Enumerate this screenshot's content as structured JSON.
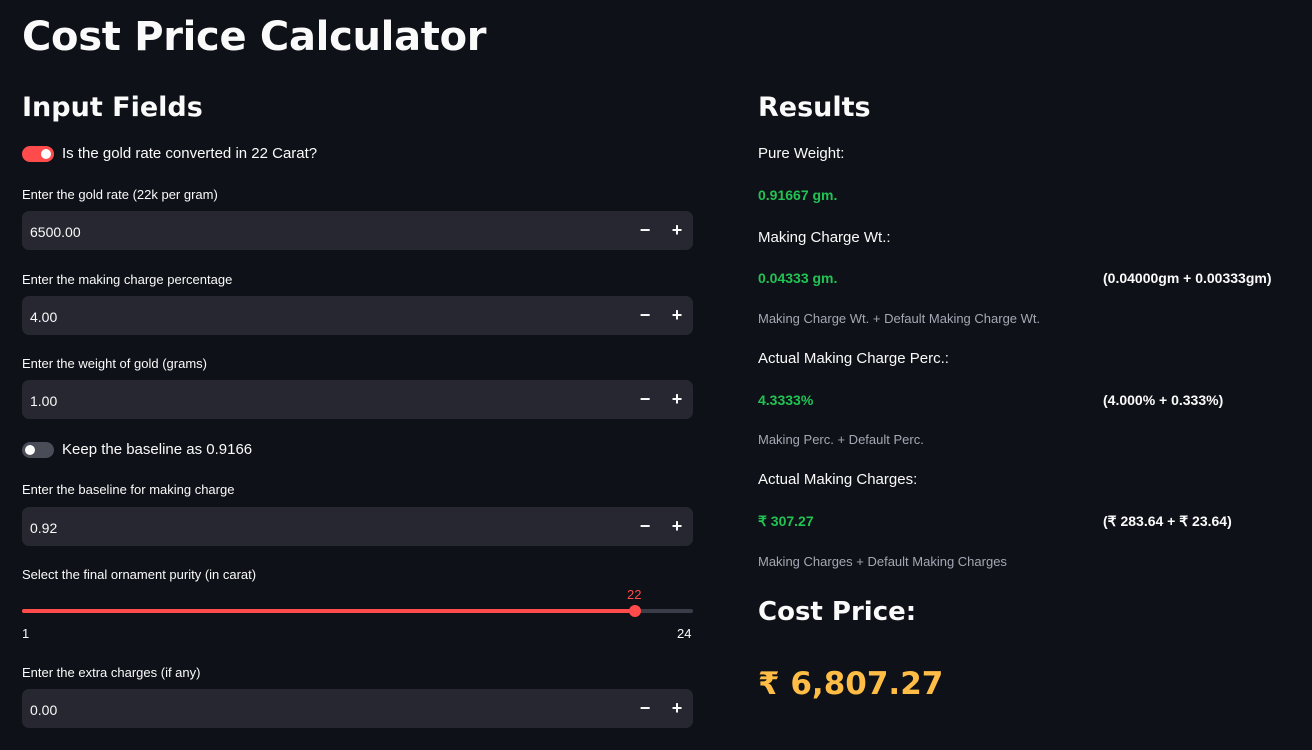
{
  "app": {
    "title": "Cost Price Calculator"
  },
  "inputs": {
    "heading": "Input Fields",
    "toggle_22k": {
      "label": "Is the gold rate converted in 22 Carat?",
      "on": true
    },
    "gold_rate": {
      "label": "Enter the gold rate (22k per gram)",
      "value": "6500.00"
    },
    "making_pct": {
      "label": "Enter the making charge percentage",
      "value": "4.00"
    },
    "weight": {
      "label": "Enter the weight of gold (grams)",
      "value": "1.00"
    },
    "toggle_baseline": {
      "label": "Keep the baseline as 0.9166",
      "on": false
    },
    "baseline": {
      "label": "Enter the baseline for making charge",
      "value": "0.92"
    },
    "purity": {
      "label": "Select the final ornament purity (in carat)",
      "value": "22",
      "min": "1",
      "max": "24"
    },
    "extra": {
      "label": "Enter the extra charges (if any)",
      "value": "0.00"
    },
    "minus_icon": "−",
    "plus_icon": "+"
  },
  "results": {
    "heading": "Results",
    "pure_weight": {
      "label": "Pure Weight:",
      "value": "0.91667 gm."
    },
    "making_wt": {
      "label": "Making Charge Wt.:",
      "value": "0.04333 gm.",
      "breakdown": "(0.04000gm + 0.00333gm)",
      "caption": "Making Charge Wt. + Default Making Charge Wt."
    },
    "making_perc": {
      "label": "Actual Making Charge Perc.:",
      "value": "4.3333%",
      "breakdown": "(4.000% + 0.333%)",
      "caption": "Making Perc. + Default Perc."
    },
    "making_charges": {
      "label": "Actual Making Charges:",
      "value": "₹ 307.27",
      "breakdown": "(₹ 283.64 + ₹ 23.64)",
      "caption": "Making Charges + Default Making Charges"
    },
    "cost": {
      "label": "Cost Price:",
      "value": "₹ 6,807.27"
    }
  },
  "colors": {
    "accent": "#ff4b4b",
    "green": "#21c354",
    "gold": "#ffbd45",
    "background": "#0e1117",
    "input_bg": "#262730"
  }
}
